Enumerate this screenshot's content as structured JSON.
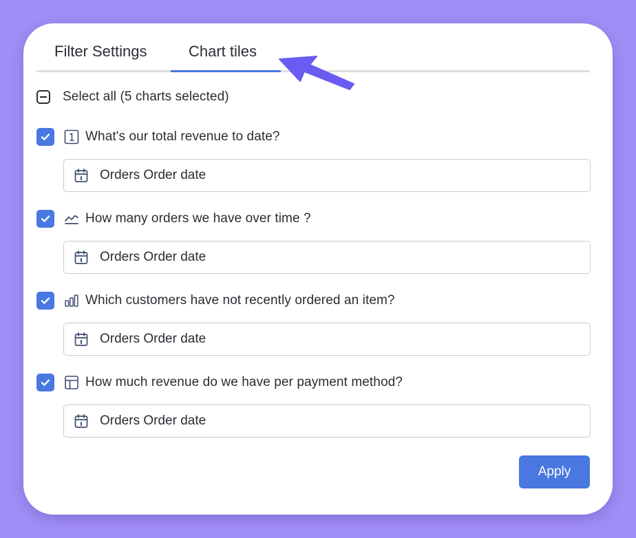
{
  "tabs": [
    {
      "label": "Filter Settings",
      "active": false
    },
    {
      "label": "Chart tiles",
      "active": true
    }
  ],
  "select_all": {
    "label": "Select all (5 charts selected)",
    "state": "indeterminate"
  },
  "charts": [
    {
      "title": "What's our total revenue to date?",
      "icon": "big-number-icon",
      "checked": true,
      "filter_field": "Orders Order date"
    },
    {
      "title": "How many orders we have over time ?",
      "icon": "line-chart-icon",
      "checked": true,
      "filter_field": "Orders Order date"
    },
    {
      "title": "Which customers have not recently ordered an item?",
      "icon": "bar-chart-icon",
      "checked": true,
      "filter_field": "Orders Order date"
    },
    {
      "title": "How much revenue do we have per payment method?",
      "icon": "table-icon",
      "checked": true,
      "filter_field": "Orders Order date"
    }
  ],
  "apply_label": "Apply",
  "colors": {
    "background": "#a08df5",
    "accent": "#4a78e0",
    "arrow": "#6a5cf2",
    "text": "#2a2d33",
    "icon": "#3d4b6e"
  },
  "icons": {
    "calendar": "calendar-icon",
    "annotation": "arrow-annotation"
  }
}
